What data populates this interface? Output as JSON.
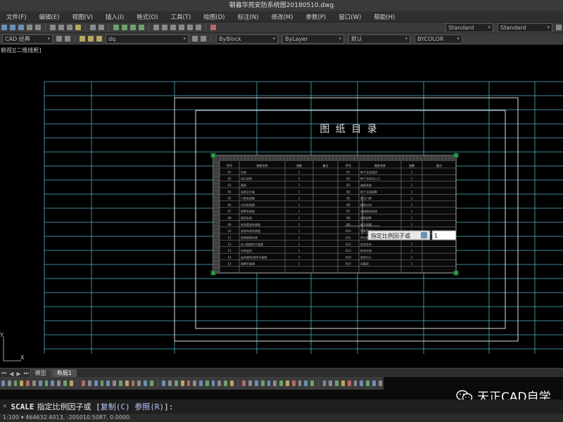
{
  "window": {
    "title": "朝暮华苑安防系统图20180510.dwg"
  },
  "menu": [
    "文件(F)",
    "编辑(E)",
    "视图(V)",
    "插入(I)",
    "格式(O)",
    "工具(T)",
    "绘图(D)",
    "标注(N)",
    "修改(M)",
    "参数(P)",
    "窗口(W)",
    "帮助(H)"
  ],
  "toolbar2": {
    "workspace": "CAD 经典",
    "layer": "dq",
    "color": "ByBlock",
    "linetype": "ByLayer",
    "lineweight": "默认",
    "plotstyle": "BYCOLOR",
    "textstyle": "Standard"
  },
  "viewport": {
    "label": "俯视][二维线框]"
  },
  "drawing": {
    "title": "图 纸 目 录",
    "table_headers": [
      "序号",
      "图纸名称",
      "张数",
      "备注",
      "序号",
      "图纸名称",
      "张数",
      "备注"
    ],
    "left_rows": [
      [
        "01",
        "目录",
        "1"
      ],
      [
        "02",
        "设计说明",
        "1"
      ],
      [
        "03",
        "图例",
        "1"
      ],
      [
        "04",
        "系统总平面",
        "1"
      ],
      [
        "05",
        "门禁系统图",
        "1"
      ],
      [
        "06",
        "对讲系统图",
        "1"
      ],
      [
        "07",
        "报警系统图",
        "1"
      ],
      [
        "08",
        "监控系统",
        "1"
      ],
      [
        "09",
        "安防管道系统图",
        "1"
      ],
      [
        "10",
        "安防布线系统图",
        "1"
      ],
      [
        "11",
        "周界报警系统",
        "1"
      ],
      [
        "12",
        "办公楼弱电平面图",
        "1"
      ],
      [
        "13",
        "车库监控",
        "1"
      ],
      [
        "14",
        "会所弱电/安防平面图",
        "1"
      ],
      [
        "15",
        "道闸平面图",
        "1"
      ]
    ],
    "right_rows": [
      [
        "B1",
        "地下车库监控",
        "1"
      ],
      [
        "B2",
        "地下车库出入口",
        "1"
      ],
      [
        "B3",
        "道闸系统",
        "1"
      ],
      [
        "B4",
        "地下车库报警",
        "1"
      ],
      [
        "B5",
        "单元门禁",
        "1"
      ],
      [
        "B6",
        "楼栋对讲",
        "1"
      ],
      [
        "B7",
        "电梯弱电系统",
        "1"
      ],
      [
        "B8",
        "消防报警",
        "1"
      ],
      [
        "B9",
        "电子巡更",
        "1"
      ],
      [
        "B10",
        "背景音乐",
        "1"
      ],
      [
        "B11",
        "停车管理",
        "1"
      ],
      [
        "B12",
        "信息发布",
        "1"
      ],
      [
        "B13",
        "综合布线",
        "1"
      ],
      [
        "B14",
        "安防中心",
        "1"
      ],
      [
        "B15",
        "设备房",
        "1"
      ]
    ],
    "prompt_label": "指定比例因子或",
    "prompt_value": "1"
  },
  "tabs": [
    "模型",
    "布局1"
  ],
  "command": {
    "close": "×",
    "keyword": "SCALE",
    "text": "指定比例因子或 [",
    "opt1": "复制(C)",
    "opt2": "参照(R)",
    "end": "]:"
  },
  "status": {
    "coords": "1:100 ▾  464632.4013, -205010.5087, 0.0000"
  },
  "watermark": {
    "text": "天正CAD自学"
  }
}
